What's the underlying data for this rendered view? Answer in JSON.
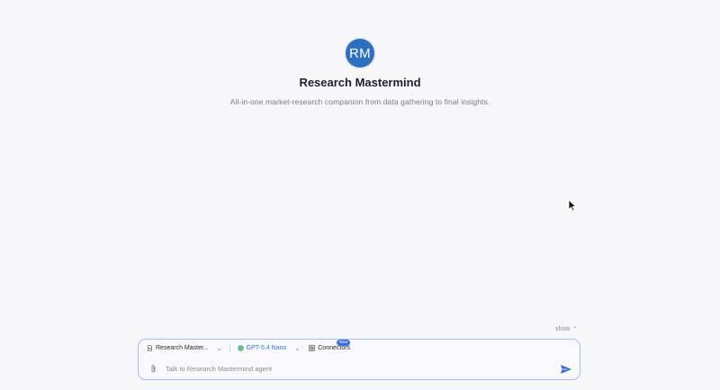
{
  "agent": {
    "initials": "RM",
    "name": "Research Mastermind",
    "description": "All-in-one market-research companion from data gathering to final insights."
  },
  "show_toggle": {
    "label": "show"
  },
  "composer": {
    "agent_selector": {
      "label": "Research Master..."
    },
    "model_selector": {
      "label": "GPT-5.4 Nano"
    },
    "connectors": {
      "label": "Connectors",
      "badge": "New"
    },
    "input": {
      "placeholder": "Talk to Research Mastermind agent",
      "value": ""
    }
  },
  "colors": {
    "avatar": "#2f6fc0",
    "accent": "#3a6ed0",
    "composer_border": "#a9bdf0",
    "background": "#f7f6f9"
  },
  "icons": [
    "document-icon",
    "chevron-down-icon",
    "model-icon",
    "grid-icon",
    "paperclip-icon",
    "send-icon",
    "chevron-up-icon",
    "mouse-cursor-icon"
  ]
}
